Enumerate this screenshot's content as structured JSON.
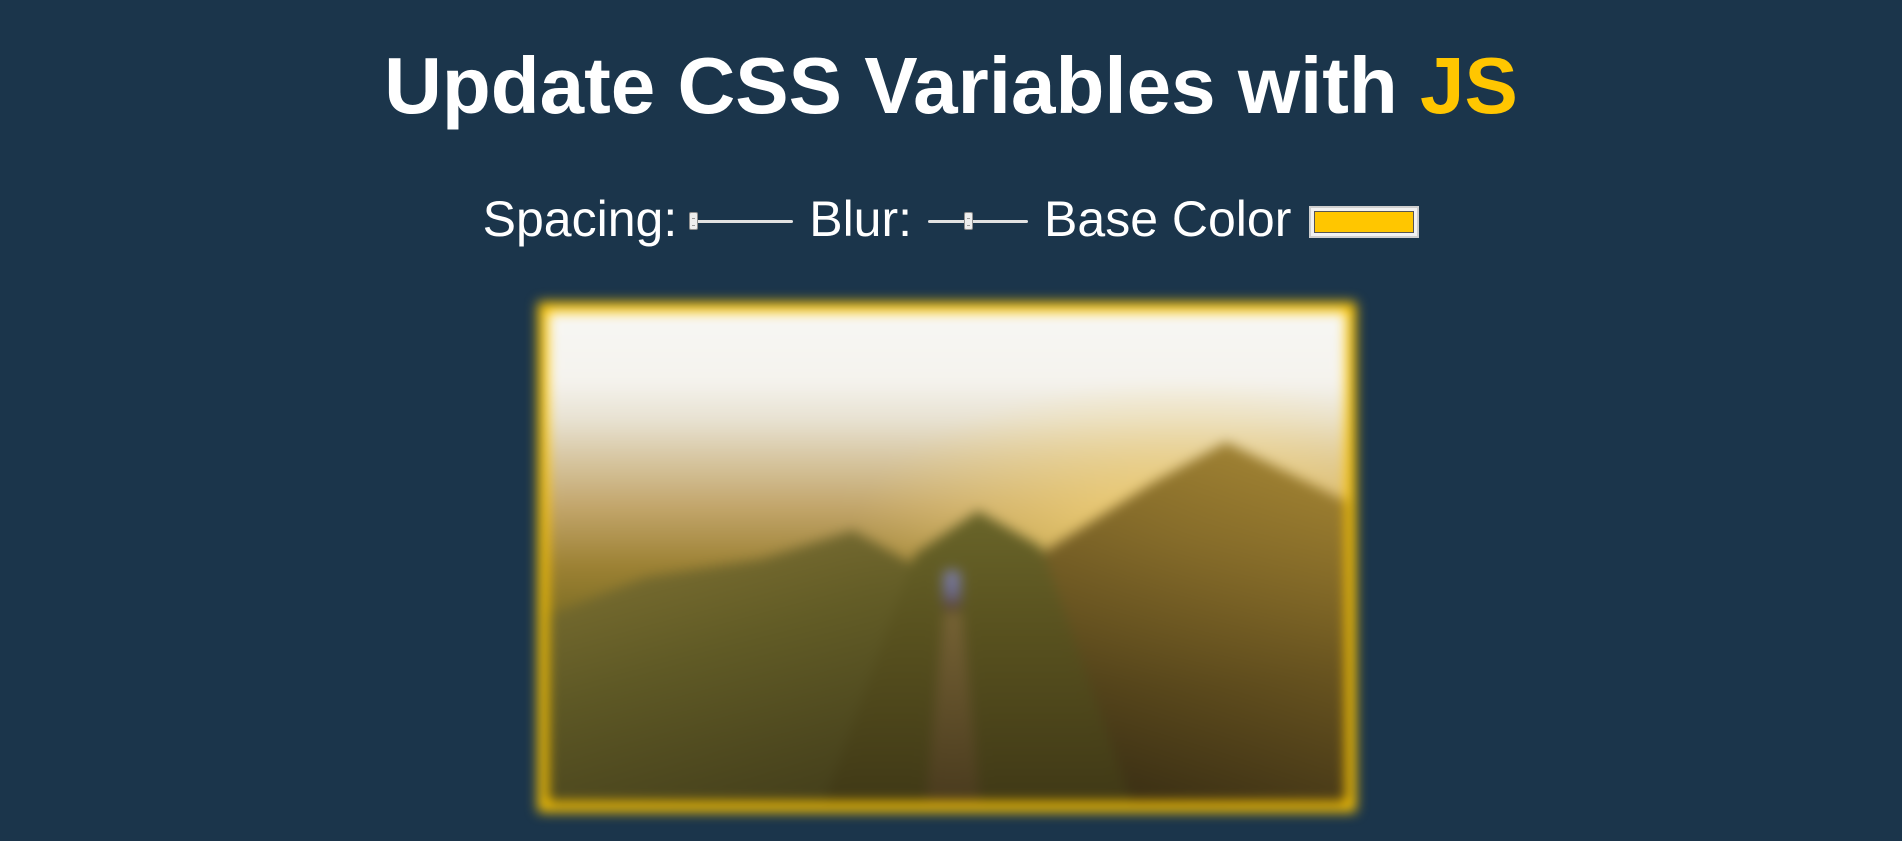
{
  "header": {
    "title_main": "Update CSS Variables with ",
    "title_highlight": "JS"
  },
  "controls": {
    "spacing_label": "Spacing:",
    "blur_label": "Blur:",
    "base_color_label": "Base Color",
    "spacing_value": 10,
    "spacing_min": 10,
    "spacing_max": 200,
    "blur_value": 10,
    "blur_min": 0,
    "blur_max": 25,
    "base_color": "#ffc600"
  },
  "colors": {
    "background": "#1b354b",
    "text": "#ffffff",
    "accent": "#ffc600"
  },
  "image": {
    "semantic": "blurred mountain ridge photo with hiker"
  }
}
